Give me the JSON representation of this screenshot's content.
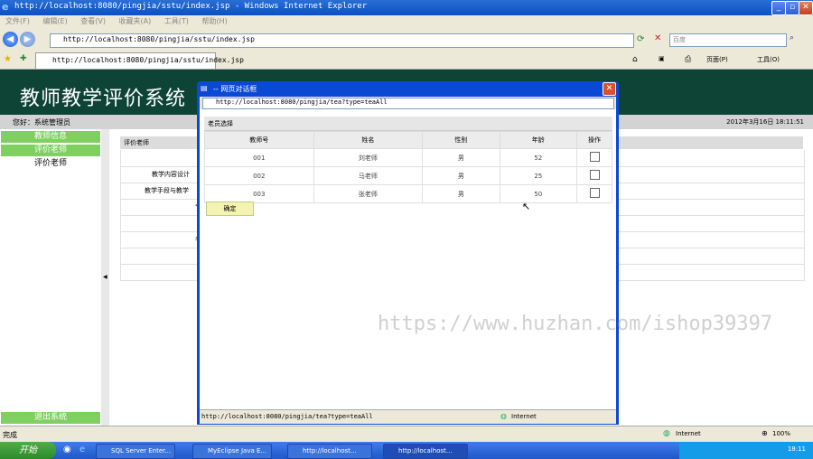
{
  "window": {
    "title": "http://localhost:8080/pingjia/sstu/index.jsp - Windows Internet Explorer"
  },
  "menubar": {
    "items": [
      "文件(F)",
      "编辑(E)",
      "查看(V)",
      "收藏夹(A)",
      "工具(T)",
      "帮助(H)"
    ]
  },
  "address": {
    "url": "http://localhost:8080/pingjia/sstu/index.jsp",
    "search_placeholder": "百度"
  },
  "tab": {
    "title": "http://localhost:8080/pingjia/sstu/index.jsp"
  },
  "toolbar": {
    "page_label": "页面(P)",
    "tools_label": "工具(O)"
  },
  "page": {
    "banner_title": "教师教学评价系统",
    "greeting": "您好：系统管理员",
    "datetime": "2012年3月16日 18:11:51",
    "nav": [
      "教师信息",
      "评价老师",
      "评价老师"
    ],
    "logout": "退出系统",
    "content_header": "评价老师",
    "content_labels": [
      "教学内容设计",
      "教学手段与教学",
      "专",
      "考"
    ]
  },
  "dialog": {
    "title": "-- 网页对话框",
    "url": "http://localhost:8080/pingjia/tea?type=teaAll",
    "section": "老员选择",
    "columns": [
      "教师号",
      "姓名",
      "性别",
      "年龄",
      "操作"
    ],
    "rows": [
      {
        "id": "001",
        "name": "刘老师",
        "gender": "男",
        "age": "52"
      },
      {
        "id": "002",
        "name": "马老师",
        "gender": "男",
        "age": "25"
      },
      {
        "id": "003",
        "name": "张老师",
        "gender": "男",
        "age": "50"
      }
    ],
    "ok": "确定",
    "status_url": "http://localhost:8080/pingjia/tea?type=teaAll",
    "zone": "Internet"
  },
  "status": {
    "text": "完成",
    "zone": "Internet",
    "zoom": "100%"
  },
  "taskbar": {
    "start": "开始",
    "tasks": [
      "SQL Server Enter...",
      "MyEclipse Java E...",
      "http://localhost...",
      "http://localhost..."
    ],
    "clock": "18:11"
  },
  "watermark": "https://www.huzhan.com/ishop39397",
  "colors": {
    "banner": "#0e4436",
    "nav_green": "#7fd061",
    "dialog_frame": "#0a49d6"
  }
}
